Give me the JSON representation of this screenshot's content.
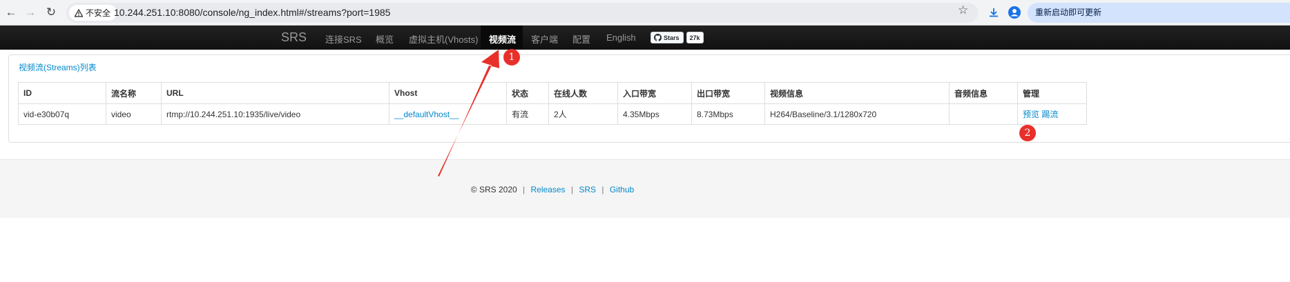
{
  "browser": {
    "security_label": "不安全",
    "url": "10.244.251.10:8080/console/ng_index.html#/streams?port=1985",
    "restart_label": "重新启动即可更新"
  },
  "navbar": {
    "brand": "SRS",
    "items": [
      {
        "label": "连接SRS"
      },
      {
        "label": "概览"
      },
      {
        "label": "虚拟主机(Vhosts)"
      },
      {
        "label": "视频流",
        "active": true
      },
      {
        "label": "客户端"
      },
      {
        "label": "配置"
      },
      {
        "label": "English"
      }
    ],
    "github": {
      "label": "Stars",
      "count": "27k"
    }
  },
  "panel": {
    "title": "视频流(Streams)列表",
    "table": {
      "headers": [
        "ID",
        "流名称",
        "URL",
        "Vhost",
        "状态",
        "在线人数",
        "入口带宽",
        "出口带宽",
        "视频信息",
        "音频信息",
        "管理"
      ],
      "rows": [
        {
          "id": "vid-e30b07q",
          "name": "video",
          "url": "rtmp://10.244.251.10:1935/live/video",
          "vhost": "__defaultVhost__",
          "status": "有流",
          "clients": "2人",
          "recv": "4.35Mbps",
          "send": "8.73Mbps",
          "video": "H264/Baseline/3.1/1280x720",
          "audio": "",
          "actions": {
            "preview": "预览",
            "kick": "踢流"
          }
        }
      ]
    }
  },
  "footer": {
    "copyright": "© SRS 2020",
    "links": [
      "Releases",
      "SRS",
      "Github"
    ]
  },
  "annotations": {
    "badge1": "1",
    "badge2": "2",
    "color": "#e8302a"
  }
}
